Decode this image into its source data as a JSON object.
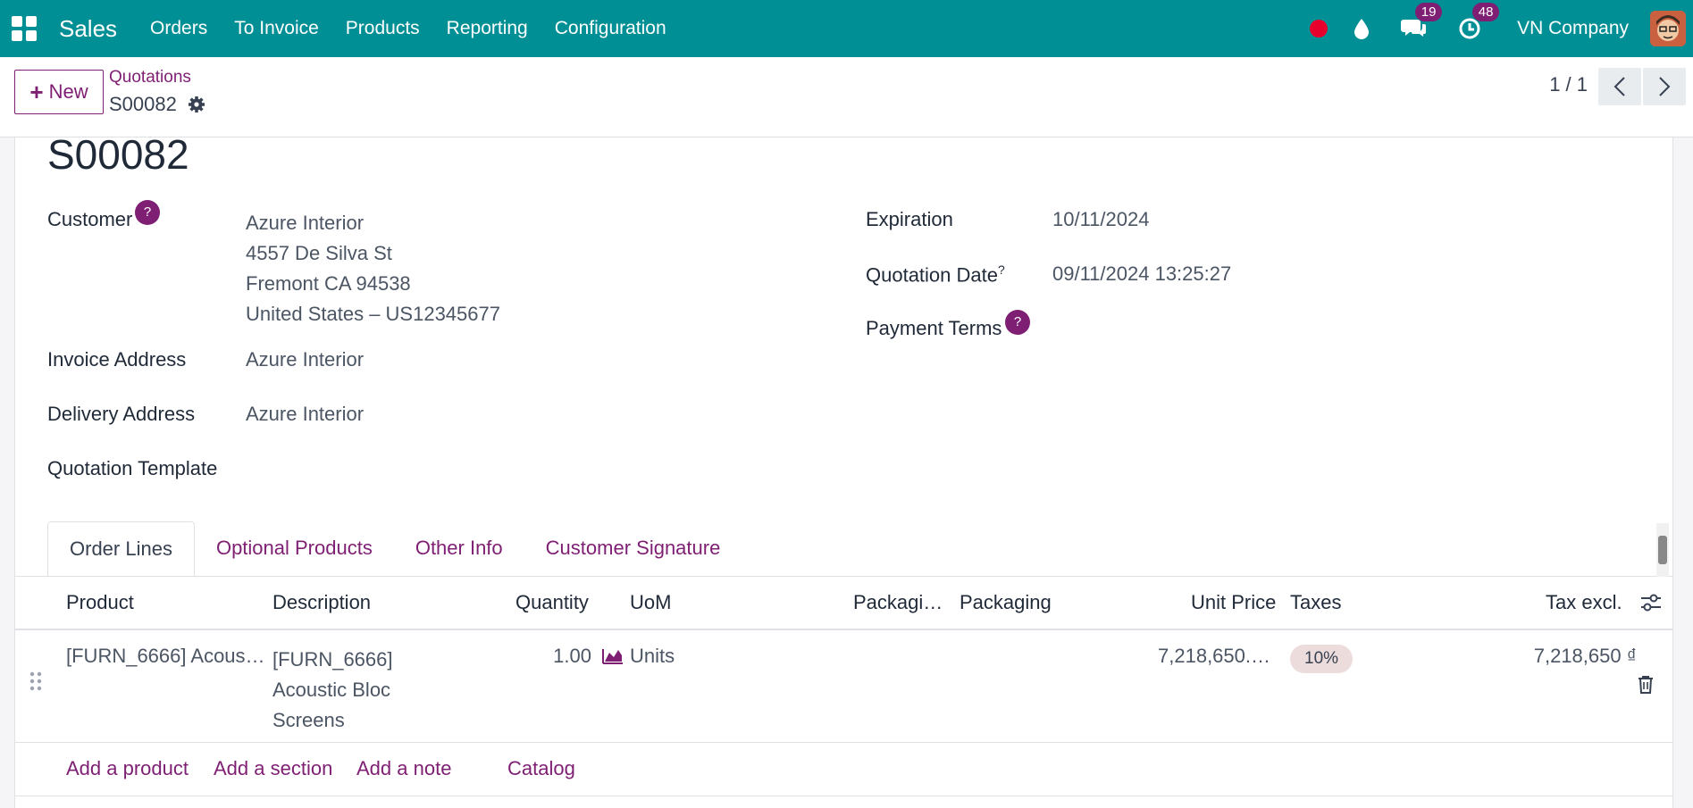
{
  "app": {
    "name": "Sales"
  },
  "nav": {
    "menu": [
      "Orders",
      "To Invoice",
      "Products",
      "Reporting",
      "Configuration"
    ],
    "messages_count": "19",
    "activities_count": "48",
    "company": "VN Company"
  },
  "control": {
    "new_label": "New",
    "breadcrumb": "Quotations",
    "record": "S00082",
    "pager": "1 / 1"
  },
  "form": {
    "title": "S00082",
    "customer_label": "Customer",
    "customer_lines": [
      "Azure Interior",
      "4557 De Silva St",
      "Fremont CA 94538",
      "United States – US12345677"
    ],
    "invoice_address_label": "Invoice Address",
    "invoice_address": "Azure Interior",
    "delivery_address_label": "Delivery Address",
    "delivery_address": "Azure Interior",
    "template_label": "Quotation Template",
    "expiration_label": "Expiration",
    "expiration": "10/11/2024",
    "quotation_date_label": "Quotation Date",
    "quotation_date": "09/11/2024 13:25:27",
    "payment_terms_label": "Payment Terms",
    "help_mark": "?"
  },
  "tabs": [
    "Order Lines",
    "Optional Products",
    "Other Info",
    "Customer Signature"
  ],
  "table": {
    "headers": [
      "Product",
      "Description",
      "Quantity",
      "UoM",
      "Packagi…",
      "Packaging",
      "Unit Price",
      "Taxes",
      "Tax excl."
    ],
    "row": {
      "product": "[FURN_6666] Acous…",
      "description": [
        "[FURN_6666]",
        "Acoustic Bloc",
        "Screens"
      ],
      "quantity": "1.00",
      "uom": "Units",
      "unit_price": "7,218,650.…",
      "tax": "10%",
      "subtotal": "7,218,650 ₫"
    },
    "actions": [
      "Add a product",
      "Add a section",
      "Add a note",
      "Catalog"
    ]
  },
  "colors": {
    "topbar": "#018f96",
    "accent": "#7e1f73"
  }
}
